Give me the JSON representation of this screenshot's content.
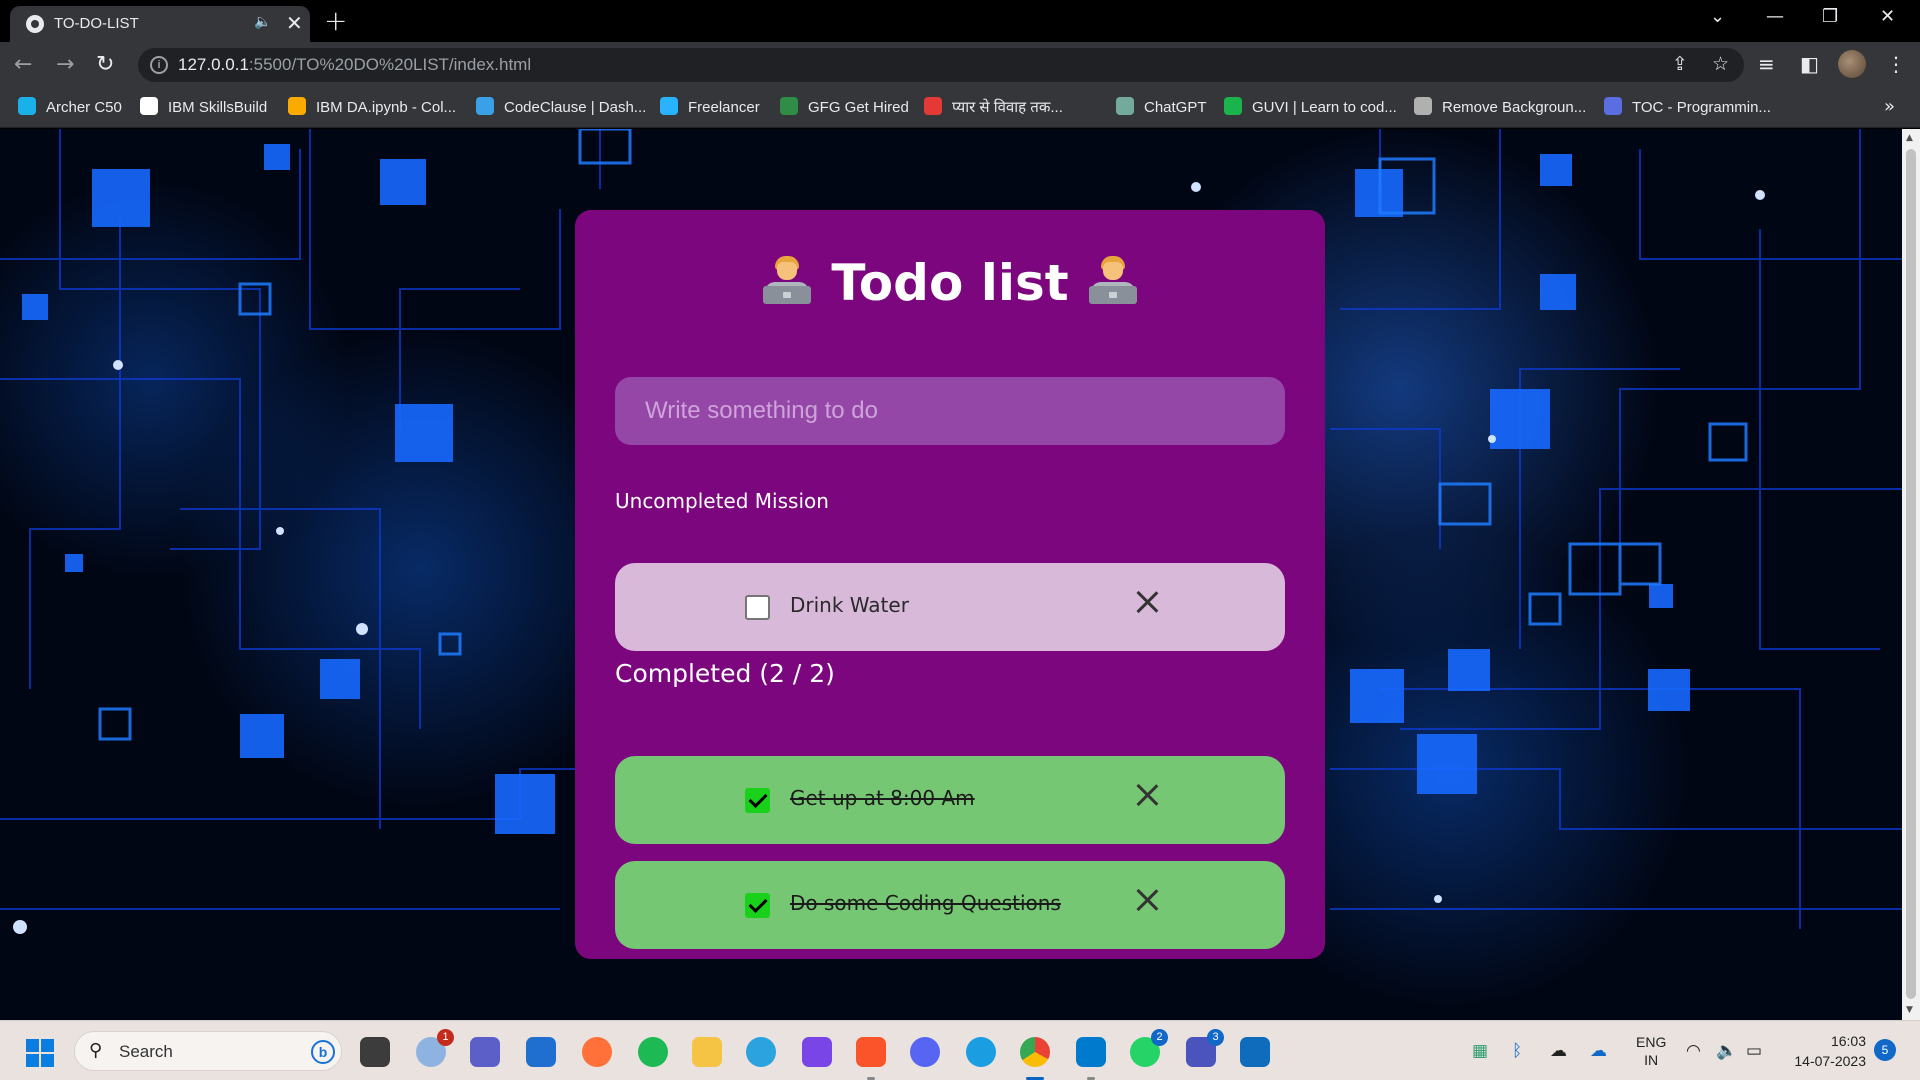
{
  "browser": {
    "tab_title": "TO-DO-LIST",
    "tab_close": "✕",
    "new_tab": "+",
    "url_host": "127.0.0.1",
    "url_path": ":5500/TO%20DO%20LIST/index.html",
    "bookmarks": [
      {
        "label": "Archer C50",
        "color": "#1ab0e8"
      },
      {
        "label": "IBM SkillsBuild",
        "color": "#ffffff"
      },
      {
        "label": "IBM DA.ipynb - Col...",
        "color": "#f9ab00"
      },
      {
        "label": "CodeClause | Dash...",
        "color": "#3aa0e8"
      },
      {
        "label": "Freelancer",
        "color": "#29b2fe"
      },
      {
        "label": "GFG Get Hired",
        "color": "#2f8d46"
      },
      {
        "label": "प्यार से विवाह तक...",
        "color": "#e53935"
      },
      {
        "label": "ChatGPT",
        "color": "#74aa9c"
      },
      {
        "label": "GUVI | Learn to cod...",
        "color": "#1bb34b"
      },
      {
        "label": "Remove Backgroun...",
        "color": "#b0b0b0"
      },
      {
        "label": "TOC - Programmin...",
        "color": "#5b6ee1"
      }
    ],
    "more_bookmarks": "»"
  },
  "app": {
    "title": "Todo list",
    "input_placeholder": "Write something to do",
    "uncompleted_label": "Uncompleted Mission",
    "completed_label": "Completed (2 / 2)",
    "uncompleted": [
      {
        "text": "Drink Water",
        "done": false
      }
    ],
    "completed": [
      {
        "text": "Get up at 8:00 Am",
        "done": true
      },
      {
        "text": "Do some Coding Questions",
        "done": true
      }
    ]
  },
  "taskbar": {
    "search_label": "Search",
    "apps": [
      {
        "name": "task-view",
        "color": "#3c3c3c"
      },
      {
        "name": "weather",
        "color": "#8fb3e0",
        "badge": "1"
      },
      {
        "name": "teams-meet",
        "color": "#5b5fc7"
      },
      {
        "name": "ms-store",
        "color": "#1e6fd0"
      },
      {
        "name": "firefox",
        "color": "#ff7139"
      },
      {
        "name": "spotify",
        "color": "#1db954"
      },
      {
        "name": "file-explorer",
        "color": "#f6c445"
      },
      {
        "name": "telegram",
        "color": "#2aa3df"
      },
      {
        "name": "clipchamp",
        "color": "#7a45e6"
      },
      {
        "name": "brave",
        "color": "#fb542b"
      },
      {
        "name": "discord",
        "color": "#5865f2"
      },
      {
        "name": "edge",
        "color": "#1b9de2"
      },
      {
        "name": "chrome",
        "color": "#4285f4",
        "active": true
      },
      {
        "name": "vscode",
        "color": "#007acc",
        "run": true
      },
      {
        "name": "whatsapp",
        "color": "#25d366",
        "badge": "2"
      },
      {
        "name": "teams",
        "color": "#4b53bc",
        "badge": "3"
      },
      {
        "name": "mail",
        "color": "#0f6cbd"
      }
    ],
    "lang_1": "ENG",
    "lang_2": "IN",
    "time": "16:03",
    "date": "14-07-2023",
    "notifications": "5"
  }
}
